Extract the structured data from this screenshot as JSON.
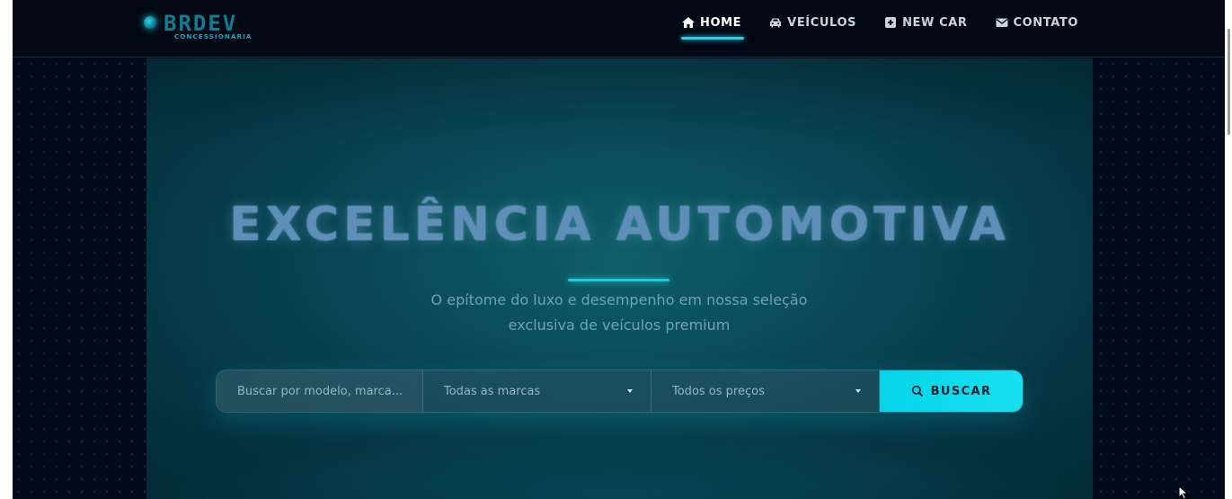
{
  "brand": {
    "name": "BRDEV",
    "subtitle": "CONCESSIONÁRIA"
  },
  "nav": {
    "items": [
      {
        "label": "HOME",
        "icon": "home-icon",
        "active": true
      },
      {
        "label": "VEÍCULOS",
        "icon": "car-icon",
        "active": false
      },
      {
        "label": "NEW CAR",
        "icon": "plus-square-icon",
        "active": false
      },
      {
        "label": "CONTATO",
        "icon": "envelope-icon",
        "active": false
      }
    ]
  },
  "hero": {
    "title": "EXCELÊNCIA AUTOMOTIVA",
    "subtitle_line1": "O epítome do luxo e desempenho em nossa seleção",
    "subtitle_line2": "exclusiva de veículos premium"
  },
  "search": {
    "placeholder": "Buscar por modelo, marca...",
    "brand_select": "Todas as marcas",
    "price_select": "Todos os preços",
    "button_label": "BUSCAR"
  },
  "colors": {
    "accent": "#19e0f0",
    "page_background": "#030b18",
    "hero_background": "#0a4a57"
  }
}
